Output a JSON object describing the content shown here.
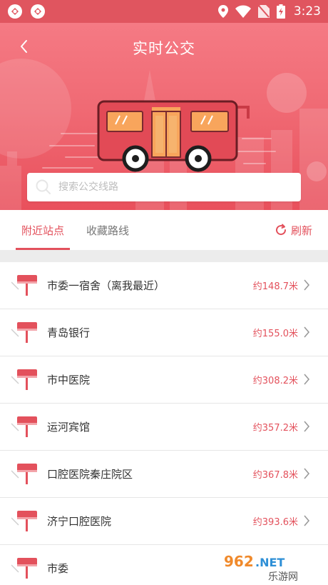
{
  "status_bar": {
    "time": "3:23"
  },
  "header": {
    "title": "实时公交",
    "search_placeholder": "搜索公交线路"
  },
  "tabs": [
    {
      "label": "附近站点",
      "active": true
    },
    {
      "label": "收藏路线",
      "active": false
    }
  ],
  "refresh_label": "刷新",
  "stations": [
    {
      "name": "市委一宿舍（离我最近）",
      "distance": "约148.7米"
    },
    {
      "name": "青岛银行",
      "distance": "约155.0米"
    },
    {
      "name": "市中医院",
      "distance": "约308.2米"
    },
    {
      "name": "运河宾馆",
      "distance": "约357.2米"
    },
    {
      "name": "口腔医院秦庄院区",
      "distance": "约367.8米"
    },
    {
      "name": "济宁口腔医院",
      "distance": "约393.6米"
    },
    {
      "name": "市委",
      "distance": ""
    }
  ],
  "watermark": {
    "brand": "962.NET",
    "site": "乐游网"
  },
  "colors": {
    "accent": "#e3515c",
    "header_top": "#f57a84",
    "header_bottom": "#e9505c"
  }
}
